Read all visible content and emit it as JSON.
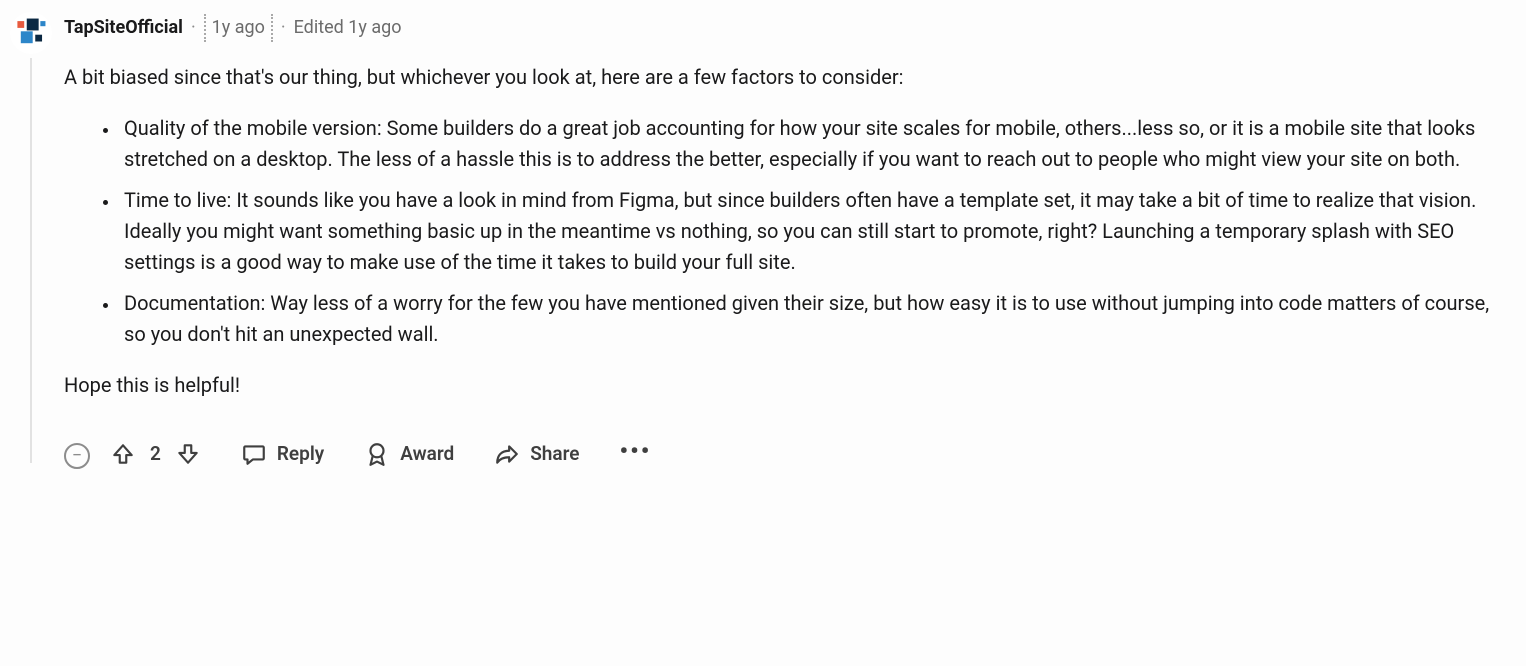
{
  "comment": {
    "username": "TapSiteOfficial",
    "timestamp": "1y ago",
    "edited_label": "Edited 1y ago",
    "intro": "A bit biased since that's our thing, but whichever you look at, here are a few factors to consider:",
    "bullets": [
      "Quality of the mobile version: Some builders do a great job accounting for how your site scales for mobile, others...less so, or it is a mobile site that looks stretched on a desktop. The less of a hassle this is to address the better, especially if you want to reach out to people who might view your site on both.",
      "Time to live: It sounds like you have a look in mind from Figma, but since builders often have a template set, it may take a bit of time to realize that vision. Ideally you might want something basic up in the meantime vs nothing, so you can still start to promote, right? Launching a temporary splash with SEO settings is a good way to make use of the time it takes to build your full site.",
      "Documentation: Way less of a worry for the few you have mentioned given their size, but how easy it is to use without jumping into code matters of course, so you don't hit an unexpected wall."
    ],
    "outro": "Hope this is helpful!"
  },
  "actions": {
    "score": "2",
    "reply_label": "Reply",
    "award_label": "Award",
    "share_label": "Share"
  },
  "icons": {
    "collapse": "−"
  }
}
